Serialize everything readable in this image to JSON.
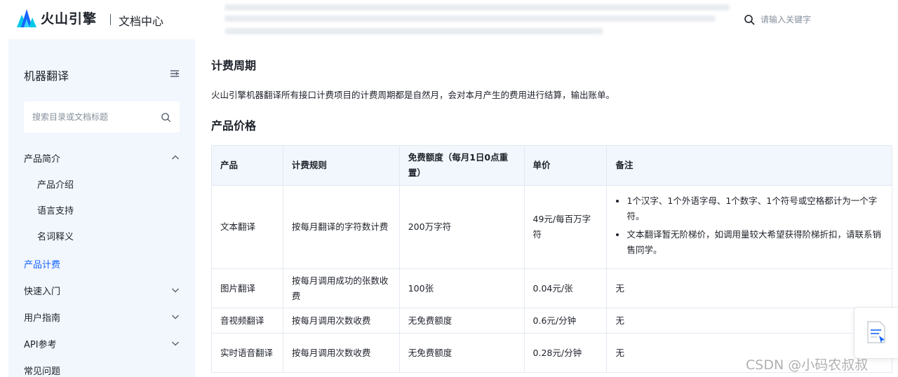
{
  "header": {
    "logo_text": "火山引擎",
    "doc_center": "文档中心",
    "search_placeholder": "请输入关键字"
  },
  "sidebar": {
    "title": "机器翻译",
    "search_placeholder": "搜索目录或文档标题",
    "items": [
      {
        "label": "产品简介",
        "level": 1,
        "expanded": true
      },
      {
        "label": "产品介绍",
        "level": 2
      },
      {
        "label": "语言支持",
        "level": 2
      },
      {
        "label": "名词释义",
        "level": 2
      },
      {
        "label": "产品计费",
        "level": 1,
        "active": true
      },
      {
        "label": "快速入门",
        "level": 1,
        "expanded": false
      },
      {
        "label": "用户指南",
        "level": 1,
        "expanded": false
      },
      {
        "label": "API参考",
        "level": 1,
        "expanded": false
      },
      {
        "label": "常见问题",
        "level": 1
      }
    ]
  },
  "content": {
    "section1_title": "计费周期",
    "section1_text": "火山引擎机器翻译所有接口计费项目的计费周期都是自然月，会对本月产生的费用进行结算，输出账单。",
    "section2_title": "产品价格",
    "table": {
      "headers": [
        "产品",
        "计费规则",
        "免费额度（每月1日0点重置）",
        "单价",
        "备注"
      ],
      "rows": [
        {
          "product": "文本翻译",
          "rule": "按每月翻译的字符数计费",
          "free": "200万字符",
          "price": "49元/每百万字符",
          "notes": [
            "1个汉字、1个外语字母、1个数字、1个符号或空格都计为一个字符。",
            "文本翻译暂无阶梯价，如调用量较大希望获得阶梯折扣，请联系销售同学。"
          ]
        },
        {
          "product": "图片翻译",
          "rule": "按每月调用成功的张数收费",
          "free": "100张",
          "price": "0.04元/张",
          "note": "无"
        },
        {
          "product": "音视频翻译",
          "rule": "按每月调用次数收费",
          "free": "无免费额度",
          "price": "0.6元/分钟",
          "note": "无"
        },
        {
          "product": "实时语音翻译",
          "rule": "按每月调用次数收费",
          "free": "无免费额度",
          "price": "0.28元/分钟",
          "note": "无"
        }
      ]
    }
  },
  "watermark": "CSDN @小码农叔叔",
  "colors": {
    "accent": "#1664ff",
    "sidebar_bg": "#f2f6fd",
    "border": "#e3e8f0"
  }
}
